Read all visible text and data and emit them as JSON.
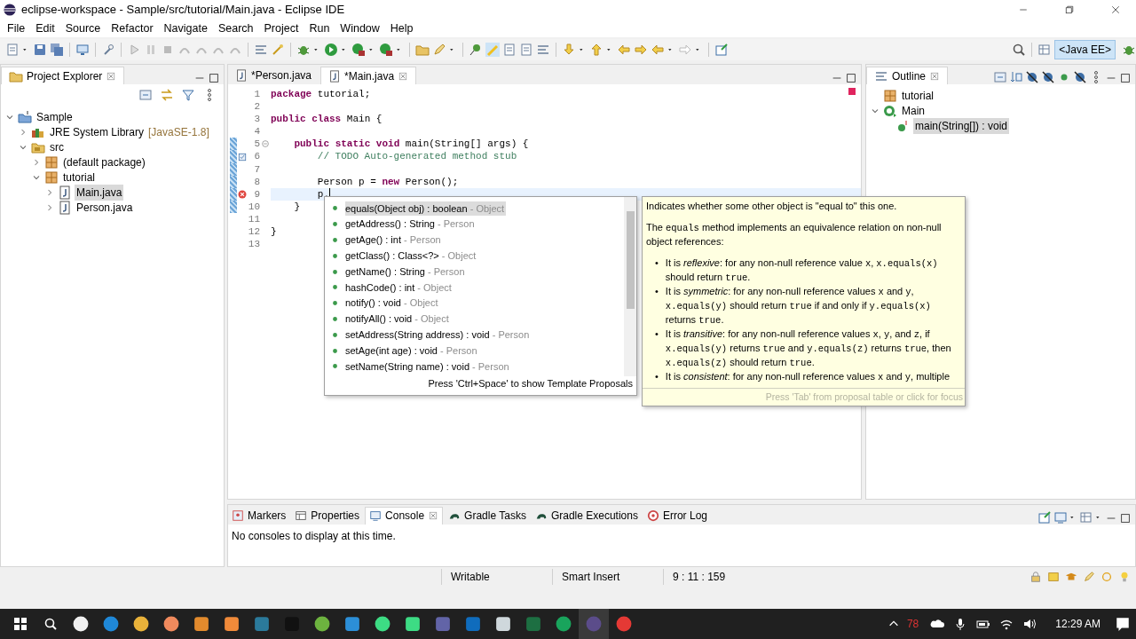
{
  "window": {
    "title": "eclipse-workspace - Sample/src/tutorial/Main.java - Eclipse IDE"
  },
  "menu": [
    "File",
    "Edit",
    "Source",
    "Refactor",
    "Navigate",
    "Search",
    "Project",
    "Run",
    "Window",
    "Help"
  ],
  "perspective": {
    "label": "<Java EE>",
    "selected": true
  },
  "project_explorer": {
    "title": "Project Explorer",
    "tree": [
      {
        "label": "Sample",
        "kind": "project",
        "expanded": true,
        "selected": false,
        "children": [
          {
            "label": "JRE System Library",
            "decoration": "[JavaSE-1.8]",
            "kind": "library",
            "expanded": false,
            "selected": false
          },
          {
            "label": "src",
            "kind": "source-folder",
            "expanded": true,
            "selected": false,
            "children": [
              {
                "label": "(default package)",
                "kind": "package",
                "expanded": false,
                "selected": false
              },
              {
                "label": "tutorial",
                "kind": "package",
                "expanded": true,
                "selected": false,
                "children": [
                  {
                    "label": "Main.java",
                    "kind": "java-file",
                    "expanded": false,
                    "selected": true
                  },
                  {
                    "label": "Person.java",
                    "kind": "java-file",
                    "expanded": false,
                    "selected": false
                  }
                ]
              }
            ]
          }
        ]
      }
    ]
  },
  "editor": {
    "tabs": [
      {
        "label": "*Person.java",
        "selected": false
      },
      {
        "label": "*Main.java",
        "selected": true
      }
    ],
    "lines": [
      {
        "number": "1",
        "text": "**package** tutorial;",
        "kind": "code",
        "changed": false,
        "current": false
      },
      {
        "number": "2",
        "changed": false,
        "current": false
      },
      {
        "number": "3",
        "text": "**public** **class** Main {",
        "kind": "code",
        "changed": false,
        "current": false
      },
      {
        "number": "4",
        "changed": false,
        "current": false
      },
      {
        "number": "5",
        "text": "    **public** **static** **void** main(String[] args) {",
        "kind": "code",
        "changed": true,
        "current": false,
        "annotation": {
          "kind": "fold"
        }
      },
      {
        "number": "6",
        "text": "        // TODO Auto-generated method stub",
        "kind": "comment",
        "changed": true,
        "current": false,
        "annotation": {
          "kind": "task"
        }
      },
      {
        "number": "7",
        "changed": true,
        "current": false
      },
      {
        "number": "8",
        "text": "        Person p = **new** Person();",
        "kind": "code",
        "changed": true,
        "current": false
      },
      {
        "number": "9",
        "text": "        p.",
        "kind": "code",
        "changed": true,
        "current": true,
        "annotation": {
          "kind": "error"
        }
      },
      {
        "number": "10",
        "text": "    }",
        "kind": "code",
        "changed": true,
        "current": false
      },
      {
        "number": "11",
        "changed": false,
        "current": false
      },
      {
        "number": "12",
        "text": "}",
        "kind": "code",
        "changed": false,
        "current": false
      },
      {
        "number": "13",
        "changed": false,
        "current": false
      }
    ]
  },
  "completion": {
    "items": [
      {
        "text": "equals(Object obj) : boolean",
        "owner": "- Object",
        "selected": true
      },
      {
        "text": "getAddress() : String",
        "owner": "- Person",
        "selected": false
      },
      {
        "text": "getAge() : int",
        "owner": "- Person",
        "selected": false
      },
      {
        "text": "getClass() : Class<?>",
        "owner": "- Object",
        "selected": false
      },
      {
        "text": "getName() : String",
        "owner": "- Person",
        "selected": false
      },
      {
        "text": "hashCode() : int",
        "owner": "- Object",
        "selected": false
      },
      {
        "text": "notify() : void",
        "owner": "- Object",
        "selected": false
      },
      {
        "text": "notifyAll() : void",
        "owner": "- Object",
        "selected": false
      },
      {
        "text": "setAddress(String address) : void",
        "owner": "- Person",
        "selected": false
      },
      {
        "text": "setAge(int age) : void",
        "owner": "- Person",
        "selected": false
      },
      {
        "text": "setName(String name) : void",
        "owner": "- Person",
        "selected": false
      }
    ],
    "footer": "Press 'Ctrl+Space' to show Template Proposals"
  },
  "javadoc": {
    "paragraphs": [
      [
        {
          "text": "Indicates whether some other object is \"equal to\" this one.",
          "kind": "plain"
        }
      ],
      [
        {
          "text": "The ",
          "kind": "plain"
        },
        {
          "text": "equals",
          "kind": "code"
        },
        {
          "text": " method implements an equivalence relation on non-null object references:",
          "kind": "plain"
        }
      ]
    ],
    "bullets": [
      {
        "marker": "•",
        "segments": [
          {
            "text": "It is ",
            "kind": "plain"
          },
          {
            "text": "reflexive",
            "kind": "italic"
          },
          {
            "text": ": for any non-null reference value ",
            "kind": "plain"
          },
          {
            "text": "x",
            "kind": "code"
          },
          {
            "text": ", ",
            "kind": "plain"
          },
          {
            "text": "x.equals(x)",
            "kind": "code"
          },
          {
            "text": " should return ",
            "kind": "plain"
          },
          {
            "text": "true",
            "kind": "code"
          },
          {
            "text": ".",
            "kind": "plain"
          }
        ]
      },
      {
        "marker": "•",
        "segments": [
          {
            "text": "It is ",
            "kind": "plain"
          },
          {
            "text": "symmetric",
            "kind": "italic"
          },
          {
            "text": ": for any non-null reference values ",
            "kind": "plain"
          },
          {
            "text": "x",
            "kind": "code"
          },
          {
            "text": " and ",
            "kind": "plain"
          },
          {
            "text": "y",
            "kind": "code"
          },
          {
            "text": ", ",
            "kind": "plain"
          },
          {
            "text": "x.equals(y)",
            "kind": "code"
          },
          {
            "text": " should return ",
            "kind": "plain"
          },
          {
            "text": "true",
            "kind": "code"
          },
          {
            "text": " if and only if ",
            "kind": "plain"
          },
          {
            "text": "y.equals(x)",
            "kind": "code"
          },
          {
            "text": " returns ",
            "kind": "plain"
          },
          {
            "text": "true",
            "kind": "code"
          },
          {
            "text": ".",
            "kind": "plain"
          }
        ]
      },
      {
        "marker": "•",
        "segments": [
          {
            "text": "It is ",
            "kind": "plain"
          },
          {
            "text": "transitive",
            "kind": "italic"
          },
          {
            "text": ": for any non-null reference values ",
            "kind": "plain"
          },
          {
            "text": "x",
            "kind": "code"
          },
          {
            "text": ", ",
            "kind": "plain"
          },
          {
            "text": "y",
            "kind": "code"
          },
          {
            "text": ", and ",
            "kind": "plain"
          },
          {
            "text": "z",
            "kind": "code"
          },
          {
            "text": ", if ",
            "kind": "plain"
          },
          {
            "text": "x.equals(y)",
            "kind": "code"
          },
          {
            "text": " returns ",
            "kind": "plain"
          },
          {
            "text": "true",
            "kind": "code"
          },
          {
            "text": " and ",
            "kind": "plain"
          },
          {
            "text": "y.equals(z)",
            "kind": "code"
          },
          {
            "text": " returns ",
            "kind": "plain"
          },
          {
            "text": "true",
            "kind": "code"
          },
          {
            "text": ", then ",
            "kind": "plain"
          },
          {
            "text": "x.equals(z)",
            "kind": "code"
          },
          {
            "text": " should return ",
            "kind": "plain"
          },
          {
            "text": "true",
            "kind": "code"
          },
          {
            "text": ".",
            "kind": "plain"
          }
        ]
      },
      {
        "marker": "•",
        "segments": [
          {
            "text": "It is ",
            "kind": "plain"
          },
          {
            "text": "consistent",
            "kind": "italic"
          },
          {
            "text": ": for any non-null reference values ",
            "kind": "plain"
          },
          {
            "text": "x",
            "kind": "code"
          },
          {
            "text": " and ",
            "kind": "plain"
          },
          {
            "text": "y",
            "kind": "code"
          },
          {
            "text": ", multiple",
            "kind": "plain"
          }
        ]
      }
    ],
    "footer": "Press 'Tab' from proposal table or click for focus"
  },
  "outline": {
    "title": "Outline",
    "tree": [
      {
        "label": "tutorial",
        "kind": "package",
        "selected": false
      },
      {
        "label": "Main",
        "kind": "class",
        "expanded": true,
        "selected": false,
        "children": [
          {
            "label": "main(String[]) : void",
            "kind": "method",
            "selected": true
          }
        ]
      }
    ]
  },
  "bottom_panel": {
    "tabs": [
      {
        "label": "Markers",
        "selected": false
      },
      {
        "label": "Properties",
        "selected": false
      },
      {
        "label": "Console",
        "selected": true
      },
      {
        "label": "Gradle Tasks",
        "selected": false
      },
      {
        "label": "Gradle Executions",
        "selected": false
      },
      {
        "label": "Error Log",
        "selected": false
      }
    ],
    "message": "No consoles to display at this time."
  },
  "status_bar": [
    "Writable",
    "Smart Insert",
    "9 : 11 : 159"
  ],
  "taskbar": {
    "tray_badge": "78",
    "time": "12:29 AM"
  }
}
